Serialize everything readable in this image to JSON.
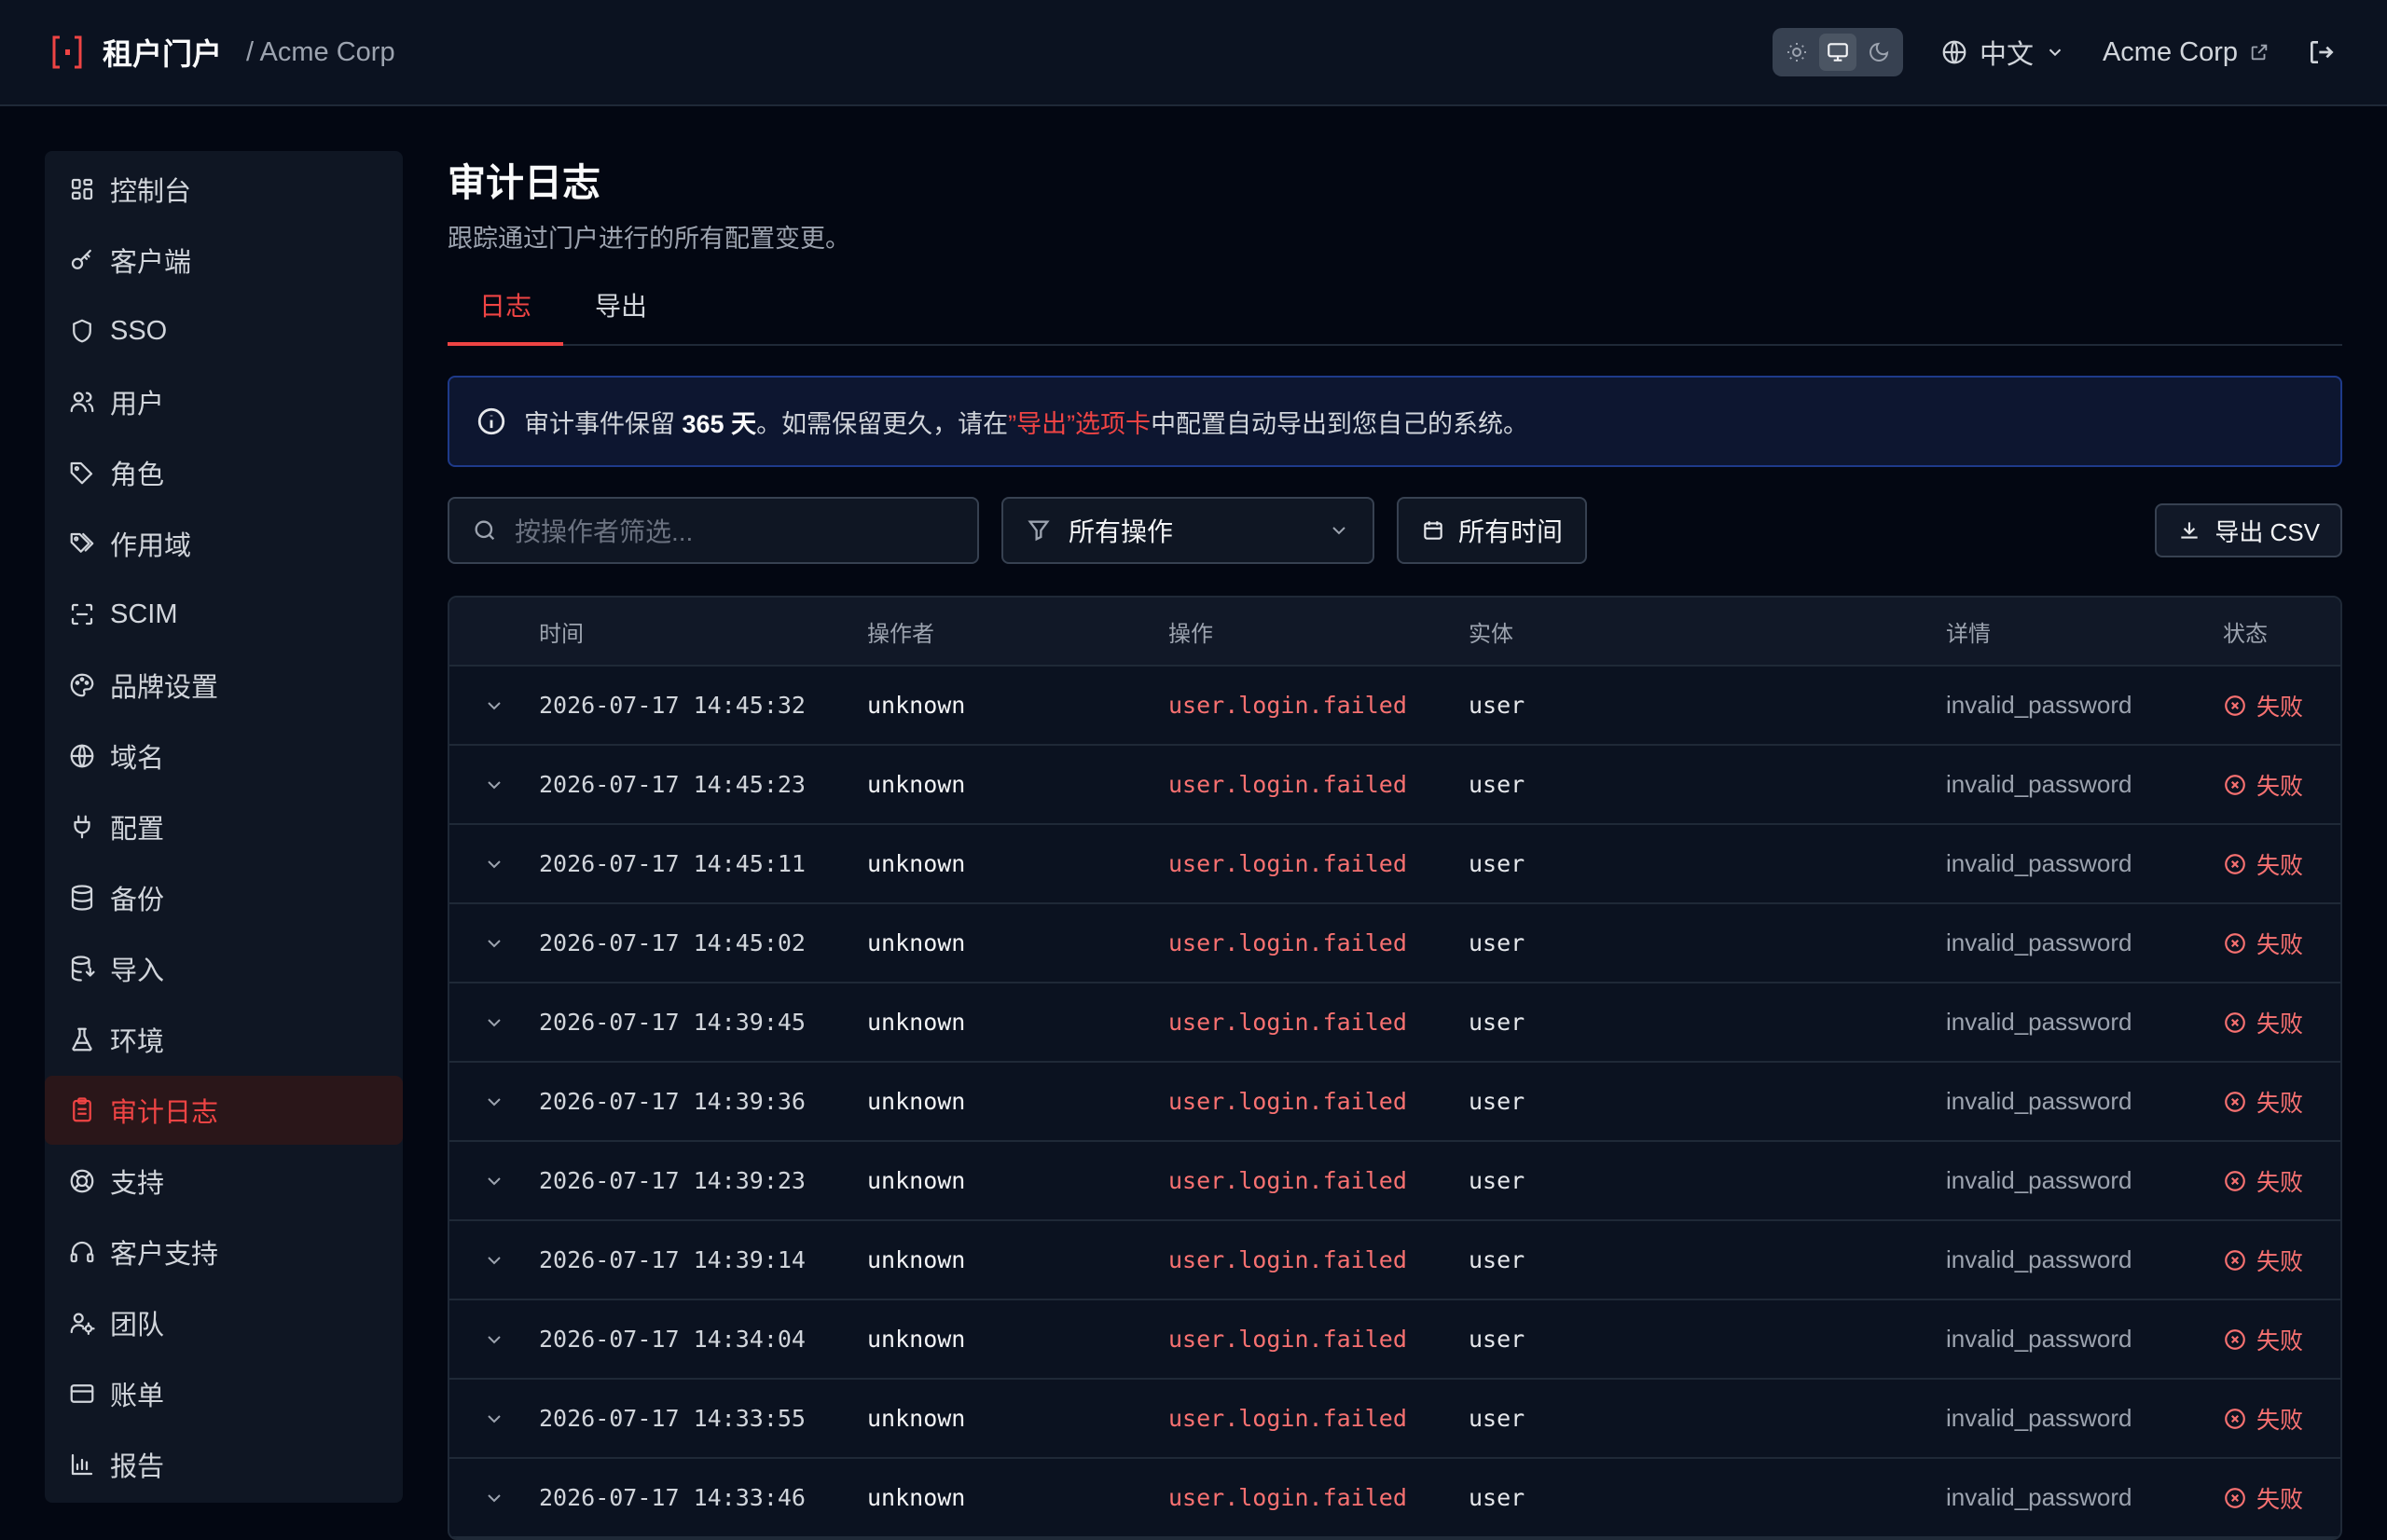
{
  "header": {
    "brand_title": "租户门户",
    "brand_sub": "/ Acme Corp",
    "language": "中文",
    "tenant": "Acme Corp"
  },
  "sidebar": {
    "items": [
      {
        "label": "控制台",
        "icon": "dashboard-icon"
      },
      {
        "label": "客户端",
        "icon": "key-icon"
      },
      {
        "label": "SSO",
        "icon": "shield-icon"
      },
      {
        "label": "用户",
        "icon": "users-icon"
      },
      {
        "label": "角色",
        "icon": "tag-icon"
      },
      {
        "label": "作用域",
        "icon": "tags-icon"
      },
      {
        "label": "SCIM",
        "icon": "scan-icon"
      },
      {
        "label": "品牌设置",
        "icon": "palette-icon"
      },
      {
        "label": "域名",
        "icon": "globe-icon"
      },
      {
        "label": "配置",
        "icon": "plug-icon"
      },
      {
        "label": "备份",
        "icon": "database-icon"
      },
      {
        "label": "导入",
        "icon": "database-import-icon"
      },
      {
        "label": "环境",
        "icon": "flask-icon"
      },
      {
        "label": "审计日志",
        "icon": "clipboard-icon",
        "active": true
      },
      {
        "label": "支持",
        "icon": "lifebuoy-icon"
      },
      {
        "label": "客户支持",
        "icon": "headset-icon"
      },
      {
        "label": "团队",
        "icon": "team-icon"
      },
      {
        "label": "账单",
        "icon": "credit-card-icon"
      },
      {
        "label": "报告",
        "icon": "bar-chart-icon"
      }
    ]
  },
  "page": {
    "title": "审计日志",
    "description": "跟踪通过门户进行的所有配置变更。",
    "tabs": [
      "日志",
      "导出"
    ]
  },
  "info": {
    "prefix": "审计事件保留 ",
    "days": "365 天",
    "middle": "。如需保留更久，请在",
    "link": "”导出”选项卡",
    "suffix": "中配置自动导出到您自己的系统。"
  },
  "toolbar": {
    "search_placeholder": "按操作者筛选...",
    "action_filter": "所有操作",
    "time_filter": "所有时间",
    "export_label": "导出 CSV"
  },
  "table": {
    "columns": [
      "时间",
      "操作者",
      "操作",
      "实体",
      "详情",
      "状态"
    ],
    "rows": [
      {
        "time": "2026-07-17 14:45:32",
        "actor": "unknown",
        "action": "user.login.failed",
        "entity": "user",
        "detail": "invalid_password",
        "status": "失败"
      },
      {
        "time": "2026-07-17 14:45:23",
        "actor": "unknown",
        "action": "user.login.failed",
        "entity": "user",
        "detail": "invalid_password",
        "status": "失败"
      },
      {
        "time": "2026-07-17 14:45:11",
        "actor": "unknown",
        "action": "user.login.failed",
        "entity": "user",
        "detail": "invalid_password",
        "status": "失败"
      },
      {
        "time": "2026-07-17 14:45:02",
        "actor": "unknown",
        "action": "user.login.failed",
        "entity": "user",
        "detail": "invalid_password",
        "status": "失败"
      },
      {
        "time": "2026-07-17 14:39:45",
        "actor": "unknown",
        "action": "user.login.failed",
        "entity": "user",
        "detail": "invalid_password",
        "status": "失败"
      },
      {
        "time": "2026-07-17 14:39:36",
        "actor": "unknown",
        "action": "user.login.failed",
        "entity": "user",
        "detail": "invalid_password",
        "status": "失败"
      },
      {
        "time": "2026-07-17 14:39:23",
        "actor": "unknown",
        "action": "user.login.failed",
        "entity": "user",
        "detail": "invalid_password",
        "status": "失败"
      },
      {
        "time": "2026-07-17 14:39:14",
        "actor": "unknown",
        "action": "user.login.failed",
        "entity": "user",
        "detail": "invalid_password",
        "status": "失败"
      },
      {
        "time": "2026-07-17 14:34:04",
        "actor": "unknown",
        "action": "user.login.failed",
        "entity": "user",
        "detail": "invalid_password",
        "status": "失败"
      },
      {
        "time": "2026-07-17 14:33:55",
        "actor": "unknown",
        "action": "user.login.failed",
        "entity": "user",
        "detail": "invalid_password",
        "status": "失败"
      },
      {
        "time": "2026-07-17 14:33:46",
        "actor": "unknown",
        "action": "user.login.failed",
        "entity": "user",
        "detail": "invalid_password",
        "status": "失败"
      }
    ]
  },
  "colors": {
    "accent": "#ef4444",
    "background": "#030712",
    "panel": "#0f1623",
    "info_border": "#1e3a8a"
  }
}
